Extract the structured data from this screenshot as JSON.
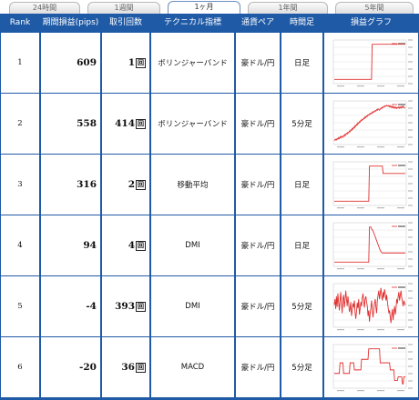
{
  "tabs": [
    {
      "label": "24時間",
      "active": false
    },
    {
      "label": "1週間",
      "active": false
    },
    {
      "label": "1ヶ月",
      "active": true
    },
    {
      "label": "1年間",
      "active": false
    },
    {
      "label": "5年間",
      "active": false
    }
  ],
  "headers": {
    "rank": "Rank",
    "profit": "期間損益(pips)",
    "trades": "取引回数",
    "indicator": "テクニカル指標",
    "pair": "通貨ペア",
    "timeframe": "時間足",
    "graph": "損益グラフ"
  },
  "trades_suffix": "回",
  "colors": {
    "header_bg": "#1f5aa6",
    "line": "#e03030",
    "grid": "#dddddd"
  },
  "rows": [
    {
      "rank": "1",
      "profit": "609",
      "trades": "1",
      "indicator": "ボリンジャーバンド",
      "pair": "豪ドル/円",
      "timeframe": "日足",
      "graph": [
        0,
        0,
        0,
        0,
        0,
        0,
        0,
        0,
        0,
        0,
        0,
        0,
        0,
        0,
        0,
        0,
        0,
        0,
        0,
        0,
        0,
        0,
        0,
        0,
        0,
        0,
        0,
        0,
        0,
        0,
        0,
        0,
        0,
        0,
        0,
        0,
        0,
        0,
        0,
        0,
        0,
        0,
        0,
        0,
        0,
        0,
        0,
        0,
        0,
        0,
        0,
        0,
        0,
        0,
        0,
        0,
        609,
        609,
        609,
        609,
        609,
        609,
        609,
        609,
        609,
        609,
        609,
        609,
        609,
        609,
        609,
        609,
        609,
        609,
        609,
        609,
        609,
        609,
        609,
        609,
        609,
        609,
        609,
        609,
        609,
        609,
        609,
        609,
        609,
        609,
        609,
        609,
        609,
        609,
        609,
        609,
        609,
        609,
        609,
        609,
        609,
        609,
        609,
        609,
        609,
        609
      ]
    },
    {
      "rank": "2",
      "profit": "558",
      "trades": "414",
      "indicator": "ボリンジャーバンド",
      "pair": "豪ドル/円",
      "timeframe": "5分足",
      "graph": [
        0,
        -12,
        8,
        -5,
        20,
        6,
        35,
        18,
        50,
        30,
        62,
        48,
        40,
        75,
        60,
        95,
        80,
        110,
        100,
        130,
        118,
        150,
        140,
        175,
        160,
        200,
        185,
        220,
        205,
        250,
        235,
        270,
        258,
        300,
        285,
        320,
        310,
        345,
        335,
        360,
        350,
        380,
        372,
        405,
        390,
        420,
        410,
        440,
        430,
        455,
        448,
        470,
        460,
        490,
        478,
        500,
        492,
        515,
        505,
        530,
        520,
        545,
        535,
        520,
        540,
        560,
        548,
        575,
        565,
        590,
        582,
        600,
        590,
        610,
        598,
        590,
        605,
        580,
        598,
        572,
        590,
        565,
        585,
        560,
        578,
        555,
        575,
        550,
        570,
        560,
        580,
        555,
        575,
        560,
        585,
        565,
        590,
        570,
        560,
        558
      ]
    },
    {
      "rank": "3",
      "profit": "316",
      "trades": "2",
      "indicator": "移動平均",
      "pair": "豪ドル/円",
      "timeframe": "日足",
      "graph": [
        0,
        0,
        0,
        0,
        0,
        0,
        0,
        0,
        0,
        0,
        0,
        0,
        0,
        0,
        0,
        0,
        0,
        0,
        0,
        0,
        0,
        0,
        0,
        0,
        0,
        0,
        0,
        0,
        0,
        0,
        0,
        0,
        0,
        0,
        0,
        0,
        0,
        0,
        0,
        0,
        0,
        0,
        0,
        0,
        0,
        0,
        0,
        0,
        0,
        400,
        400,
        400,
        400,
        400,
        400,
        400,
        400,
        400,
        400,
        400,
        400,
        400,
        400,
        400,
        400,
        400,
        400,
        400,
        316,
        316,
        316,
        316,
        316,
        316,
        316,
        316,
        316,
        316,
        316,
        316,
        316,
        316,
        316,
        316,
        316,
        316,
        316,
        316,
        316,
        316,
        316,
        316,
        316,
        316,
        316,
        316,
        316,
        316,
        316,
        316
      ]
    },
    {
      "rank": "4",
      "profit": "94",
      "trades": "4",
      "indicator": "DMI",
      "pair": "豪ドル/円",
      "timeframe": "日足",
      "graph": [
        0,
        0,
        0,
        0,
        0,
        0,
        0,
        0,
        0,
        0,
        0,
        0,
        0,
        0,
        0,
        0,
        0,
        0,
        0,
        0,
        0,
        0,
        0,
        0,
        0,
        0,
        0,
        0,
        0,
        0,
        0,
        0,
        0,
        0,
        0,
        0,
        0,
        0,
        0,
        0,
        0,
        0,
        0,
        0,
        0,
        0,
        0,
        0,
        0,
        360,
        360,
        360,
        340,
        330,
        320,
        300,
        280,
        260,
        240,
        220,
        200,
        180,
        160,
        140,
        120,
        110,
        100,
        94,
        94,
        94,
        94,
        94,
        94,
        94,
        94,
        94,
        94,
        94,
        94,
        94,
        94,
        94,
        94,
        94,
        94,
        94,
        94,
        94,
        94,
        94,
        94,
        94,
        94,
        94,
        94,
        94,
        94,
        94,
        94,
        94
      ]
    },
    {
      "rank": "5",
      "profit": "-4",
      "trades": "393",
      "indicator": "DMI",
      "pair": "豪ドル/円",
      "timeframe": "5分足",
      "graph": [
        0,
        80,
        -60,
        120,
        -30,
        160,
        40,
        -80,
        60,
        180,
        20,
        -120,
        90,
        140,
        -40,
        60,
        200,
        80,
        -20,
        120,
        30,
        -100,
        -60,
        40,
        -160,
        -80,
        20,
        -40,
        60,
        -120,
        -200,
        -90,
        30,
        -50,
        80,
        -140,
        -60,
        40,
        -20,
        100,
        160,
        60,
        -40,
        80,
        120,
        40,
        -20,
        -160,
        -80,
        -240,
        -120,
        -40,
        60,
        -80,
        -180,
        -60,
        20,
        80,
        -40,
        -120,
        60,
        140,
        200,
        80,
        160,
        240,
        120,
        60,
        180,
        100,
        220,
        160,
        60,
        140,
        40,
        -40,
        -120,
        -80,
        -180,
        -260,
        -140,
        -60,
        -220,
        -100,
        -20,
        -140,
        -60,
        80,
        20,
        120,
        180,
        60,
        140,
        200,
        100,
        40,
        -20,
        60,
        20,
        -4
      ]
    },
    {
      "rank": "6",
      "profit": "-20",
      "trades": "36",
      "indicator": "MACD",
      "pair": "豪ドル/円",
      "timeframe": "5分足",
      "graph": [
        0,
        0,
        0,
        0,
        0,
        0,
        0,
        0,
        60,
        60,
        60,
        60,
        60,
        0,
        0,
        0,
        0,
        0,
        0,
        0,
        0,
        0,
        60,
        60,
        60,
        60,
        60,
        60,
        20,
        20,
        20,
        20,
        20,
        20,
        20,
        20,
        20,
        20,
        80,
        80,
        80,
        80,
        80,
        80,
        80,
        80,
        80,
        80,
        140,
        140,
        140,
        140,
        140,
        140,
        140,
        140,
        140,
        140,
        140,
        140,
        140,
        140,
        140,
        140,
        60,
        60,
        60,
        60,
        60,
        60,
        60,
        60,
        60,
        60,
        60,
        60,
        60,
        60,
        20,
        20,
        20,
        20,
        20,
        20,
        -40,
        -40,
        -40,
        -40,
        -40,
        -20,
        -20,
        -20,
        -20,
        -20,
        -20,
        -60,
        -60,
        -20,
        -20,
        -20
      ]
    }
  ]
}
